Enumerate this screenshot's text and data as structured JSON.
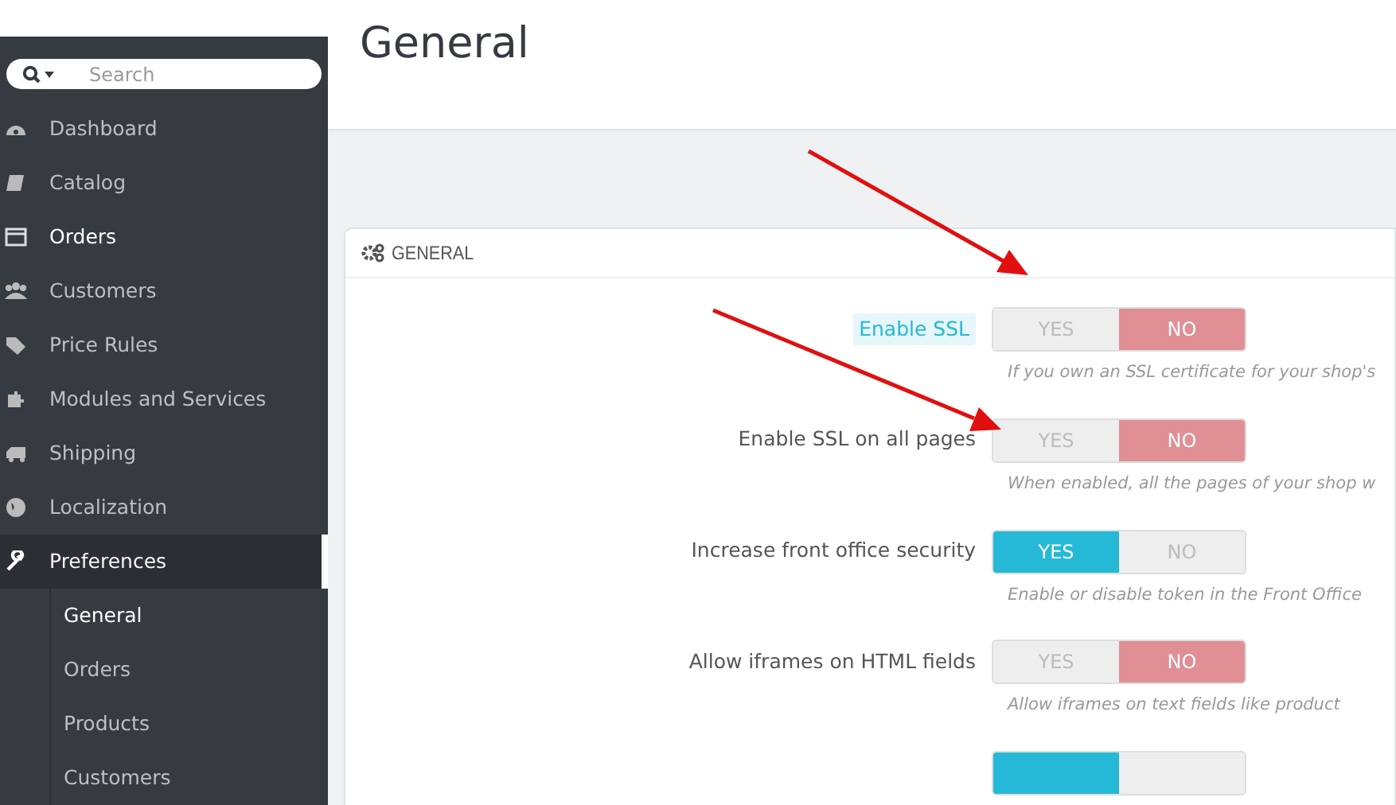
{
  "page_title": "General",
  "search": {
    "placeholder": "Search"
  },
  "sidebar": {
    "items": [
      {
        "label": "Dashboard",
        "selected": false,
        "hovered": false
      },
      {
        "label": "Catalog",
        "selected": false,
        "hovered": false
      },
      {
        "label": "Orders",
        "selected": false,
        "hovered": true
      },
      {
        "label": "Customers",
        "selected": false,
        "hovered": false
      },
      {
        "label": "Price Rules",
        "selected": false,
        "hovered": false
      },
      {
        "label": "Modules and Services",
        "selected": false,
        "hovered": false
      },
      {
        "label": "Shipping",
        "selected": false,
        "hovered": false
      },
      {
        "label": "Localization",
        "selected": false,
        "hovered": false
      },
      {
        "label": "Preferences",
        "selected": true,
        "hovered": false,
        "children": [
          {
            "label": "General",
            "selected": true
          },
          {
            "label": "Orders",
            "selected": false
          },
          {
            "label": "Products",
            "selected": false
          },
          {
            "label": "Customers",
            "selected": false
          }
        ]
      }
    ]
  },
  "panel": {
    "title": "GENERAL",
    "settings": [
      {
        "label": "Enable SSL",
        "highlighted": true,
        "value": false,
        "yes": "YES",
        "no": "NO",
        "hint": "If you own an SSL certificate for your shop's"
      },
      {
        "label": "Enable SSL on all pages",
        "highlighted": false,
        "value": false,
        "yes": "YES",
        "no": "NO",
        "hint": "When enabled, all the pages of your shop w"
      },
      {
        "label": "Increase front office security",
        "highlighted": false,
        "value": true,
        "yes": "YES",
        "no": "NO",
        "hint": "Enable or disable token in the Front Office"
      },
      {
        "label": "Allow iframes on HTML fields",
        "highlighted": false,
        "value": false,
        "yes": "YES",
        "no": "NO",
        "hint": "Allow iframes on text fields like product"
      },
      {
        "value": true
      }
    ]
  }
}
